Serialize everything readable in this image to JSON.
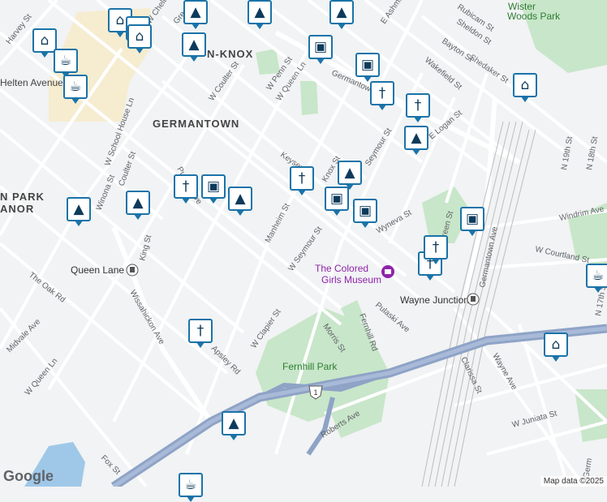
{
  "map": {
    "places": [
      "GERMANTOWN",
      "N-KNOX",
      "N PARK",
      "ANOR"
    ],
    "parks": [
      "Wister",
      "Woods Park",
      "Fernhill Park"
    ],
    "poi": "The Colored Girls Museum",
    "stations": [
      "Queen Lane",
      "Wayne Junction"
    ],
    "highway_shield": "1",
    "streets": [
      "Harvey St",
      "W Cheltenham Ave",
      "Greene St",
      "W Penn St",
      "W Queen Ln",
      "Germantown Ave",
      "E Ashmead St",
      "Rubicam St",
      "Sheldon St",
      "Bayton St",
      "Shedaker St",
      "Wakefield St",
      "Helten Avenue",
      "W School House Ln",
      "W Coulter St",
      "Coulter St",
      "Pulaski Ave",
      "Winona St",
      "King St",
      "Wissahickon Ave",
      "The Oak Rd",
      "Midvale Ave",
      "W Queen Ln",
      "Manheim St",
      "W Seymour St",
      "Seymour St",
      "Keyser St",
      "E Logan St",
      "Wyneva St",
      "Germantown Ave",
      "W Courtland St",
      "N 19th St",
      "N 18th St",
      "N 17th St",
      "Windrim Ave",
      "Fernhill Rd",
      "Morris St",
      "Pulaski Ave",
      "W Clapier St",
      "Apsley Rd",
      "Clarissa St",
      "Wayne Ave",
      "W Juniata St",
      "Roberts Ave",
      "Fox St",
      "Green St",
      "Knox St",
      "Germ"
    ],
    "pins": [
      {
        "icon": "shopping-cart-icon"
      },
      {
        "icon": "shopping-cart-icon"
      },
      {
        "icon": "shopping-cart-icon"
      },
      {
        "icon": "shopping-cart-icon"
      },
      {
        "icon": "coffee-icon"
      },
      {
        "icon": "coffee-icon"
      },
      {
        "icon": "school-icon"
      },
      {
        "icon": "school-icon"
      },
      {
        "icon": "school-icon"
      },
      {
        "icon": "shopping-bag-icon"
      },
      {
        "icon": "shopping-bag-icon"
      },
      {
        "icon": "restaurant-icon"
      },
      {
        "icon": "restaurant-icon"
      },
      {
        "icon": "school-icon"
      },
      {
        "icon": "shopping-cart-icon"
      },
      {
        "icon": "school-icon"
      },
      {
        "icon": "restaurant-icon"
      },
      {
        "icon": "shopping-bag-icon"
      },
      {
        "icon": "school-icon"
      },
      {
        "icon": "school-icon"
      },
      {
        "icon": "school-icon"
      },
      {
        "icon": "restaurant-icon"
      },
      {
        "icon": "shopping-bag-icon"
      },
      {
        "icon": "shopping-bag-icon"
      },
      {
        "icon": "shopping-bag-icon"
      },
      {
        "icon": "restaurant-icon"
      },
      {
        "icon": "restaurant-icon"
      },
      {
        "icon": "shopping-cart-icon"
      },
      {
        "icon": "restaurant-icon"
      },
      {
        "icon": "school-icon"
      },
      {
        "icon": "coffee-icon"
      },
      {
        "icon": "coffee-icon"
      },
      {
        "icon": "school-icon"
      }
    ],
    "colors": {
      "background": "#f1f3f4",
      "park": "#c8e6c9",
      "highway": "#8ea3c6",
      "commercial": "#f6ecd0",
      "pin_border": "#1a73a8",
      "water": "#9fc8e8"
    }
  },
  "footer": {
    "logo": "Google",
    "attribution": "Map data ©2025"
  }
}
